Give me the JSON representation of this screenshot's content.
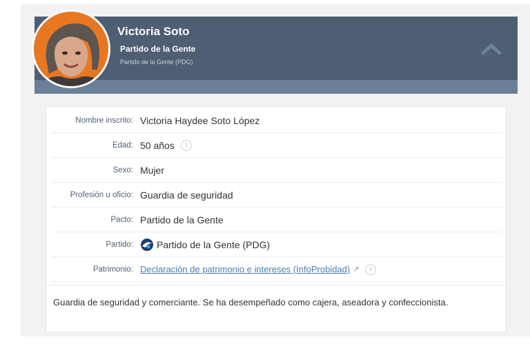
{
  "profile": {
    "name": "Victoria Soto",
    "party": "Partido de la Gente",
    "party_full": "Partido de la Gente (PDG)",
    "collapse_icon": "chevron-up-icon"
  },
  "details": {
    "rows": [
      {
        "label": "Nombre inscrito:",
        "value": "Victoria Haydee Soto López"
      },
      {
        "label": "Edad:",
        "value": "50 años",
        "icon": "info-icon"
      },
      {
        "label": "Sexo:",
        "value": "Mujer"
      },
      {
        "label": "Profesión u oficio:",
        "value": "Guardia de seguridad"
      },
      {
        "label": "Pacto:",
        "value": "Partido de la Gente"
      },
      {
        "label": "Partido:",
        "value": "Partido de la Gente (PDG)",
        "icon": "party-logo-icon"
      },
      {
        "label": "Patrimonio:",
        "value": "Declaración de patrimonio e intereses (InfoProbidad)",
        "icons": [
          "external-link-icon",
          "info-icon"
        ]
      }
    ],
    "info_glyph": "i",
    "external_glyph": "↗"
  },
  "description": "Guardia de seguridad y comerciante. Se ha desempeñado como cajera, aseadora y confeccionista.",
  "colors": {
    "header": "#4e5e73",
    "header_strip": "#6b7f99",
    "avatar_bg": "#e87722",
    "label": "#536076",
    "link": "#4d7bb0"
  }
}
